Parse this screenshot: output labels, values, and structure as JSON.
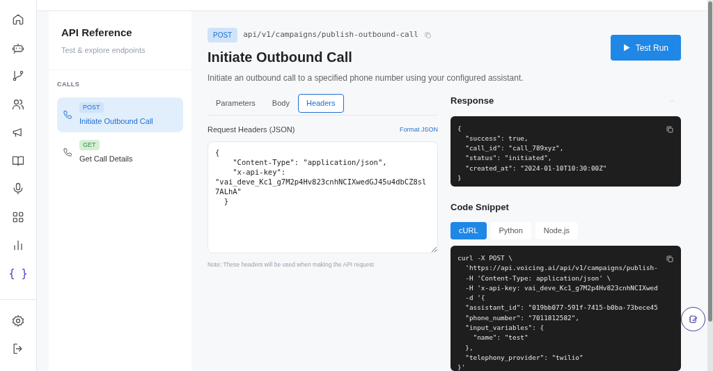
{
  "rail": {
    "items": [
      {
        "kind": "home",
        "selected": false
      },
      {
        "kind": "bot",
        "selected": false
      },
      {
        "kind": "branch",
        "selected": false
      },
      {
        "kind": "users",
        "selected": false
      },
      {
        "kind": "megaphone",
        "selected": false
      },
      {
        "kind": "book",
        "selected": false
      },
      {
        "kind": "mic",
        "selected": false
      },
      {
        "kind": "grid",
        "selected": false
      },
      {
        "kind": "chart",
        "selected": false
      },
      {
        "kind": "glyph",
        "glyph": "{ }",
        "selected": true
      }
    ],
    "bottom": [
      {
        "kind": "settings"
      },
      {
        "kind": "logout"
      }
    ]
  },
  "sidebar": {
    "title": "API Reference",
    "subtitle": "Test & explore endpoints",
    "section": "CALLS",
    "items": [
      {
        "method": "POST",
        "label": "Initiate Outbound Call",
        "selected": true
      },
      {
        "method": "GET",
        "label": "Get Call Details",
        "selected": false
      }
    ]
  },
  "endpoint": {
    "method": "POST",
    "path": "api/v1/campaigns/publish-outbound-call",
    "title": "Initiate Outbound Call",
    "description": "Initiate an outbound call to a specified phone number using your configured assistant.",
    "run_button": "Test Run"
  },
  "tabs": [
    {
      "label": "Parameters",
      "selected": false
    },
    {
      "label": "Body",
      "selected": false
    },
    {
      "label": "Headers",
      "selected": true
    }
  ],
  "headers": {
    "label": "Request Headers (JSON)",
    "format_link": "Format JSON",
    "value": "{\n    \"Content-Type\": \"application/json\",\n    \"x-api-key\": \"vai_deve_Kc1_g7M2p4Hv823cnhNCIXwedGJ45u4dbCZ8sl7ALhA\"\n  }",
    "note": "Note: These headers will be used when making the API request"
  },
  "response": {
    "title": "Response",
    "expanded": true,
    "code": "{\n  \"success\": true,\n  \"call_id\": \"call_789xyz\",\n  \"status\": \"initiated\",\n  \"created_at\": \"2024-01-10T10:30:00Z\"\n}"
  },
  "snippet": {
    "title": "Code Snippet",
    "tabs": [
      {
        "label": "cURL",
        "selected": true
      },
      {
        "label": "Python",
        "selected": false
      },
      {
        "label": "Node.js",
        "selected": false
      }
    ],
    "code": "curl -X POST \\\n  'https://api.voicing.ai/api/v1/campaigns/publish-\n  -H 'Content-Type: application/json' \\\n  -H 'x-api-key: vai_deve_Kc1_g7M2p4Hv823cnhNCIXwed\n  -d '{\n  \"assistant_id\": \"019bb077-591f-7415-b0ba-73bece45\n  \"phone_number\": \"7011812582\",\n  \"input_variables\": {\n    \"name\": \"test\"\n  },\n  \"telephony_provider\": \"twilio\"\n}'"
  }
}
